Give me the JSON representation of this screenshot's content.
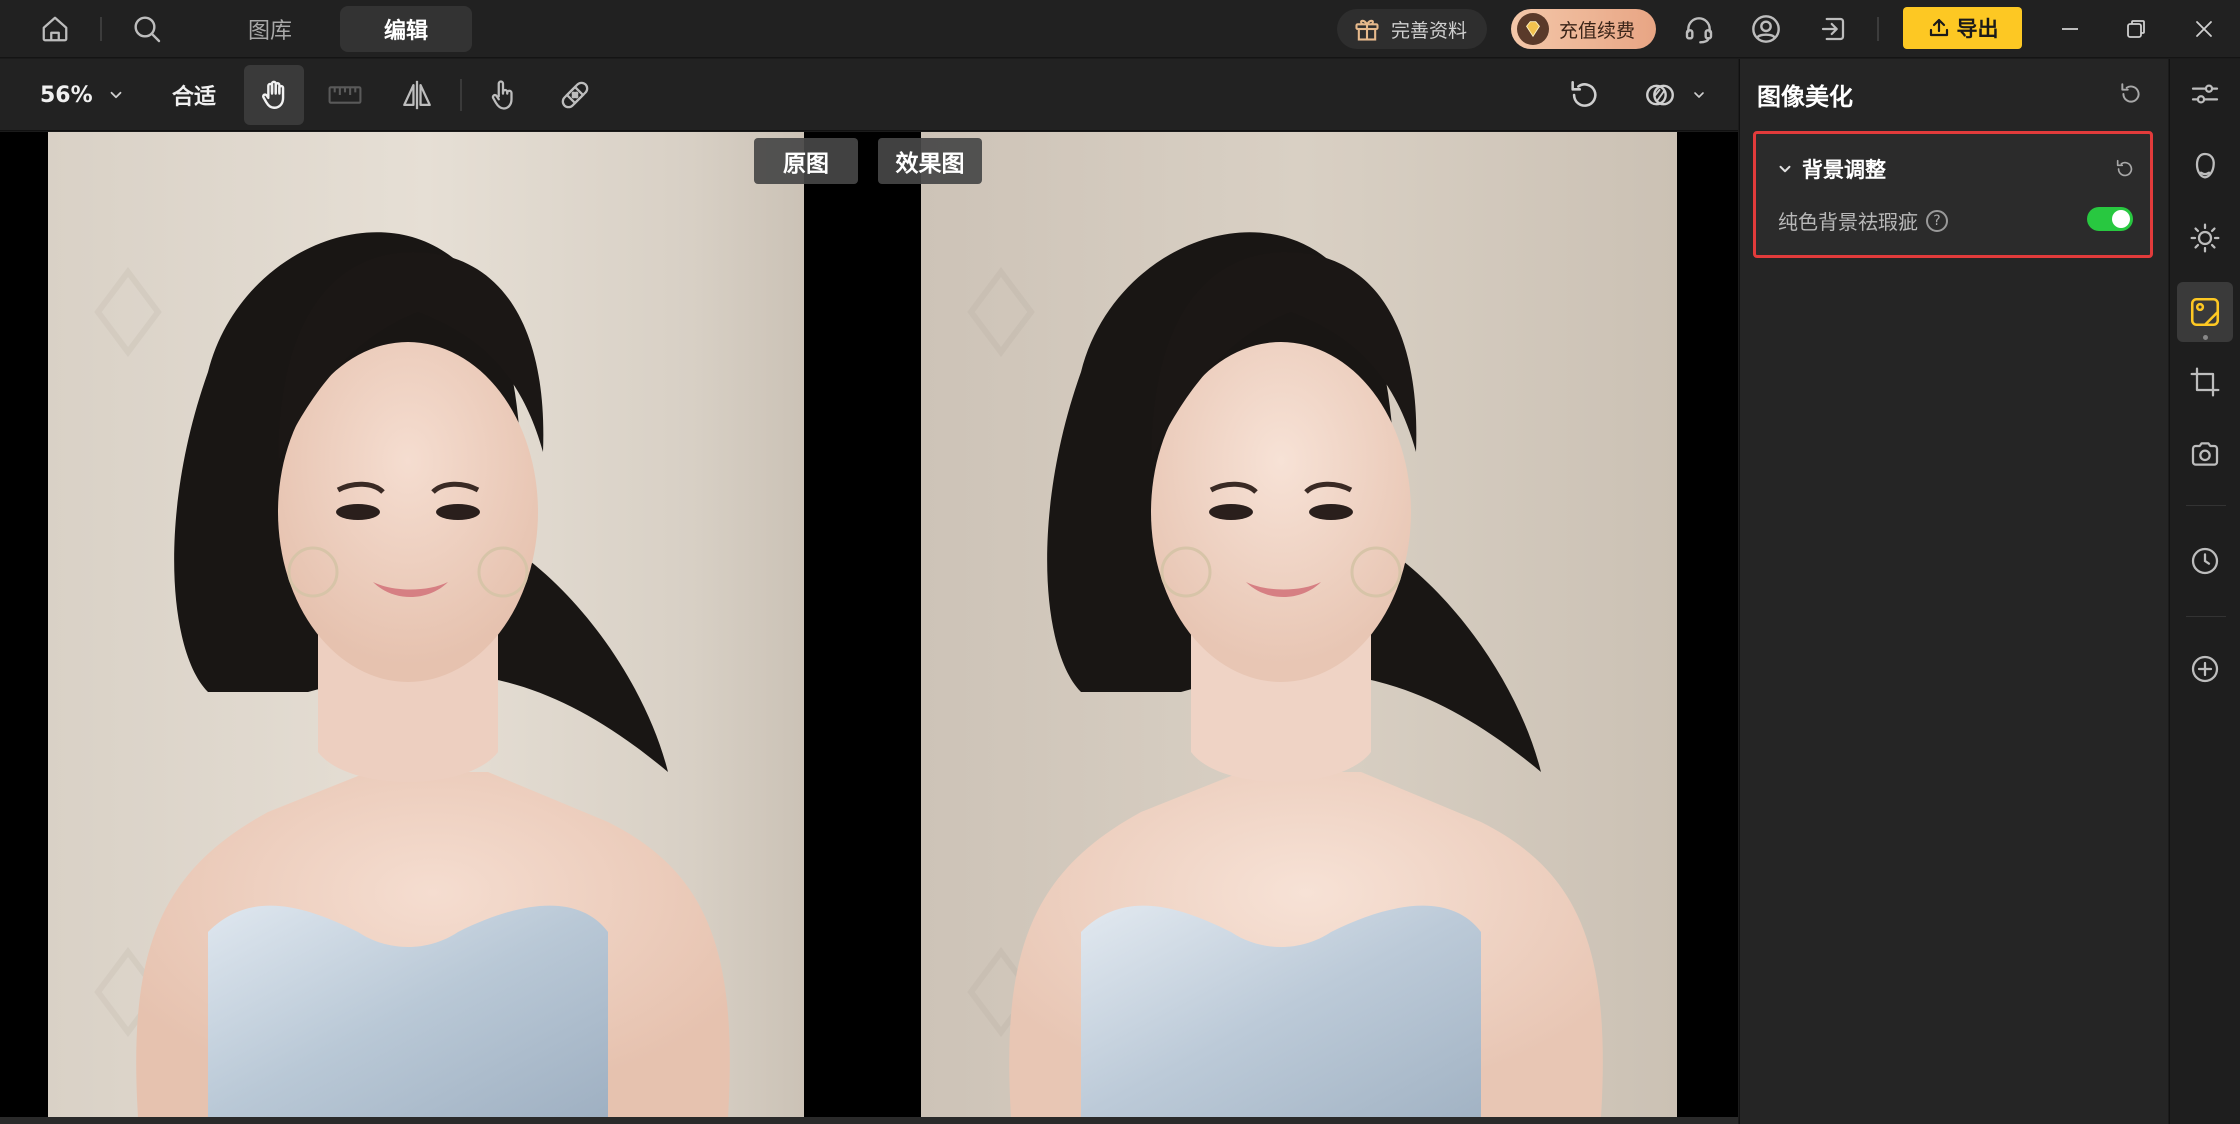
{
  "titlebar": {
    "nav_tabs": [
      {
        "label": "图库",
        "active": false
      },
      {
        "label": "编辑",
        "active": true
      }
    ],
    "gift_label": "完善资料",
    "vip_label": "充值续费",
    "export_label": "导出",
    "accent_color": "#fdc823"
  },
  "toolbar": {
    "zoom": "56%",
    "fit_label": "合适",
    "active_tool": "hand"
  },
  "canvas": {
    "labels": {
      "original": "原图",
      "result": "效果图"
    }
  },
  "panel": {
    "title": "图像美化",
    "section": {
      "title": "背景调整",
      "expanded": true,
      "highlight_color": "#e23b3b",
      "option_label": "纯色背景祛瑕疵",
      "option_enabled": true,
      "toggle_color": "#28c840"
    }
  },
  "sidebar": {
    "items": [
      {
        "icon": "sliders-icon"
      },
      {
        "icon": "face-icon"
      },
      {
        "icon": "brightness-icon"
      },
      {
        "icon": "background-icon",
        "active": true
      },
      {
        "icon": "crop-icon"
      },
      {
        "icon": "camera-icon"
      },
      {
        "icon": "history-icon"
      },
      {
        "icon": "add-icon"
      }
    ]
  }
}
